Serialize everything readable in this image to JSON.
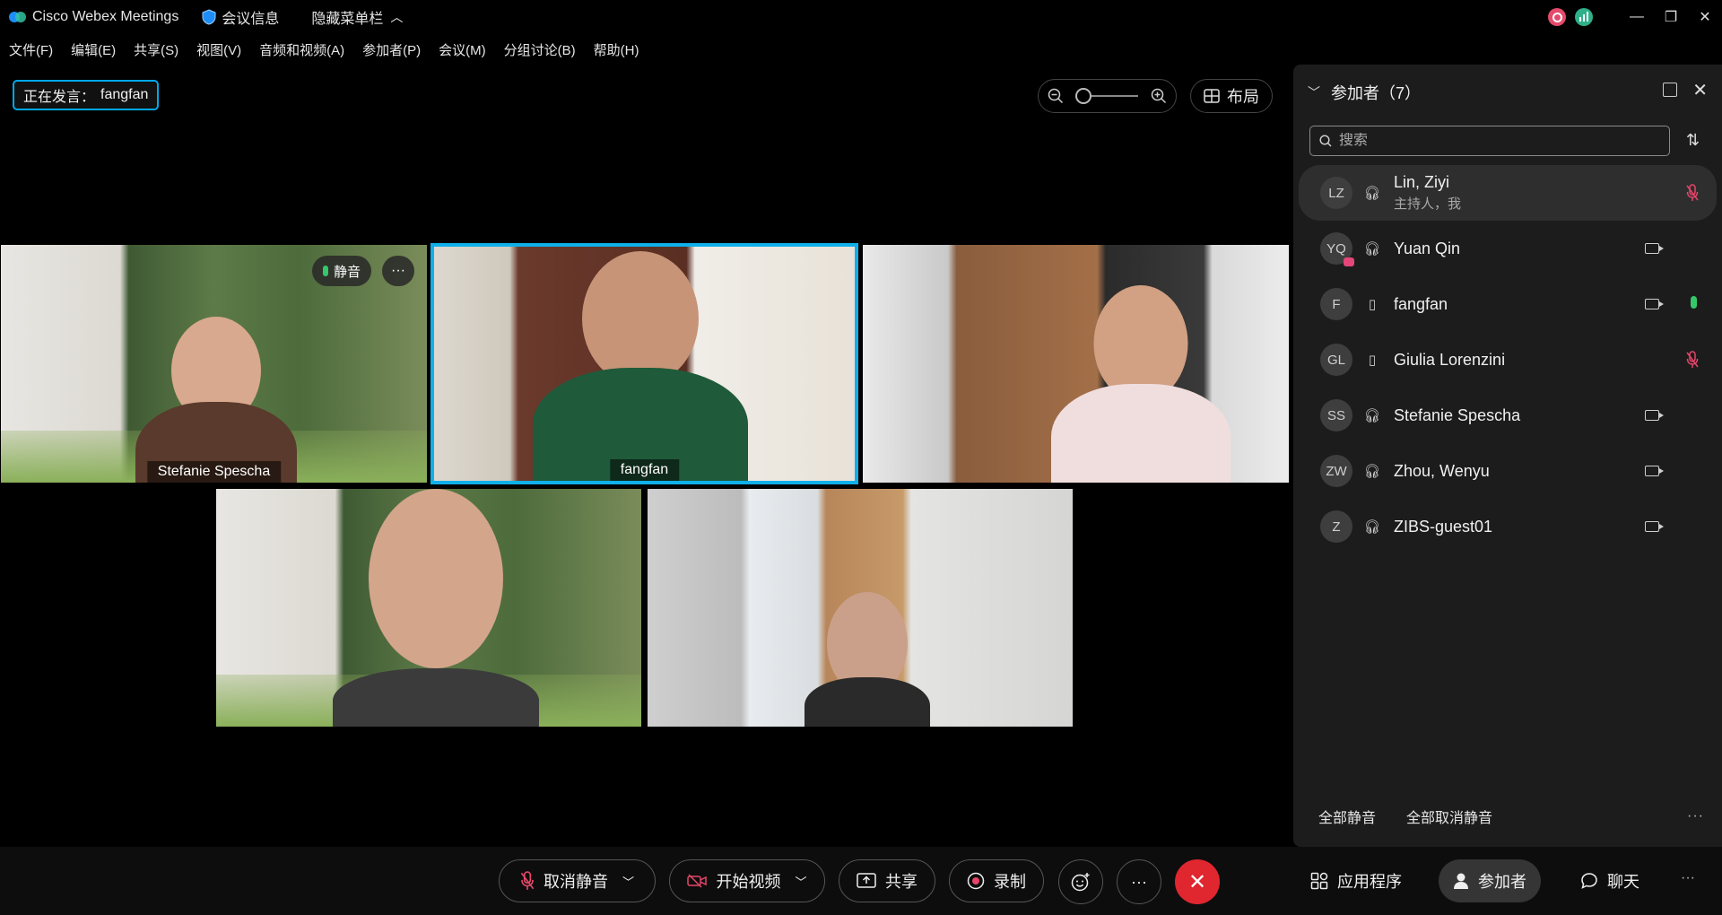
{
  "titlebar": {
    "app_title": "Cisco Webex Meetings",
    "meeting_info": "会议信息",
    "hide_menu": "隐藏菜单栏"
  },
  "menu": [
    "文件(F)",
    "编辑(E)",
    "共享(S)",
    "视图(V)",
    "音频和视频(A)",
    "参加者(P)",
    "会议(M)",
    "分组讨论(B)",
    "帮助(H)"
  ],
  "speaking": {
    "label": "正在发言：",
    "name": "fangfan"
  },
  "zoom": {
    "level": 0
  },
  "layout_button": "布局",
  "tiles": [
    {
      "name": "Stefanie Spescha",
      "mute_chip": "静音",
      "active": false
    },
    {
      "name": "fangfan",
      "active": true
    },
    {
      "name": "",
      "active": false
    },
    {
      "name": "",
      "active": false
    },
    {
      "name": "",
      "active": false
    }
  ],
  "panel": {
    "title": "参加者（7）",
    "search_placeholder": "搜索",
    "participants": [
      {
        "initials": "LZ",
        "name": "Lin, Ziyi",
        "role": "主持人，我",
        "conn": "headset",
        "video": false,
        "mic": "muted"
      },
      {
        "initials": "YQ",
        "name": "Yuan Qin",
        "role": "",
        "conn": "headset",
        "video": true,
        "mic": "none"
      },
      {
        "initials": "F",
        "name": "fangfan",
        "role": "",
        "conn": "phone",
        "video": true,
        "mic": "active"
      },
      {
        "initials": "GL",
        "name": "Giulia Lorenzini",
        "role": "",
        "conn": "phone",
        "video": false,
        "mic": "muted"
      },
      {
        "initials": "SS",
        "name": "Stefanie Spescha",
        "role": "",
        "conn": "headset",
        "video": true,
        "mic": "none"
      },
      {
        "initials": "ZW",
        "name": "Zhou, Wenyu",
        "role": "",
        "conn": "headset",
        "video": true,
        "mic": "none"
      },
      {
        "initials": "Z",
        "name": "ZIBS-guest01",
        "role": "",
        "conn": "headset",
        "video": true,
        "mic": "none"
      }
    ],
    "footer": {
      "mute_all": "全部静音",
      "unmute_all": "全部取消静音"
    }
  },
  "controls": {
    "unmute": "取消静音",
    "start_video": "开始视频",
    "share": "共享",
    "record": "录制",
    "apps": "应用程序",
    "participants": "参加者",
    "chat": "聊天"
  },
  "colors": {
    "accent": "#0fb0ea",
    "end_call": "#e0262f",
    "mic_active": "#35c86a",
    "muted": "#e5466a"
  }
}
